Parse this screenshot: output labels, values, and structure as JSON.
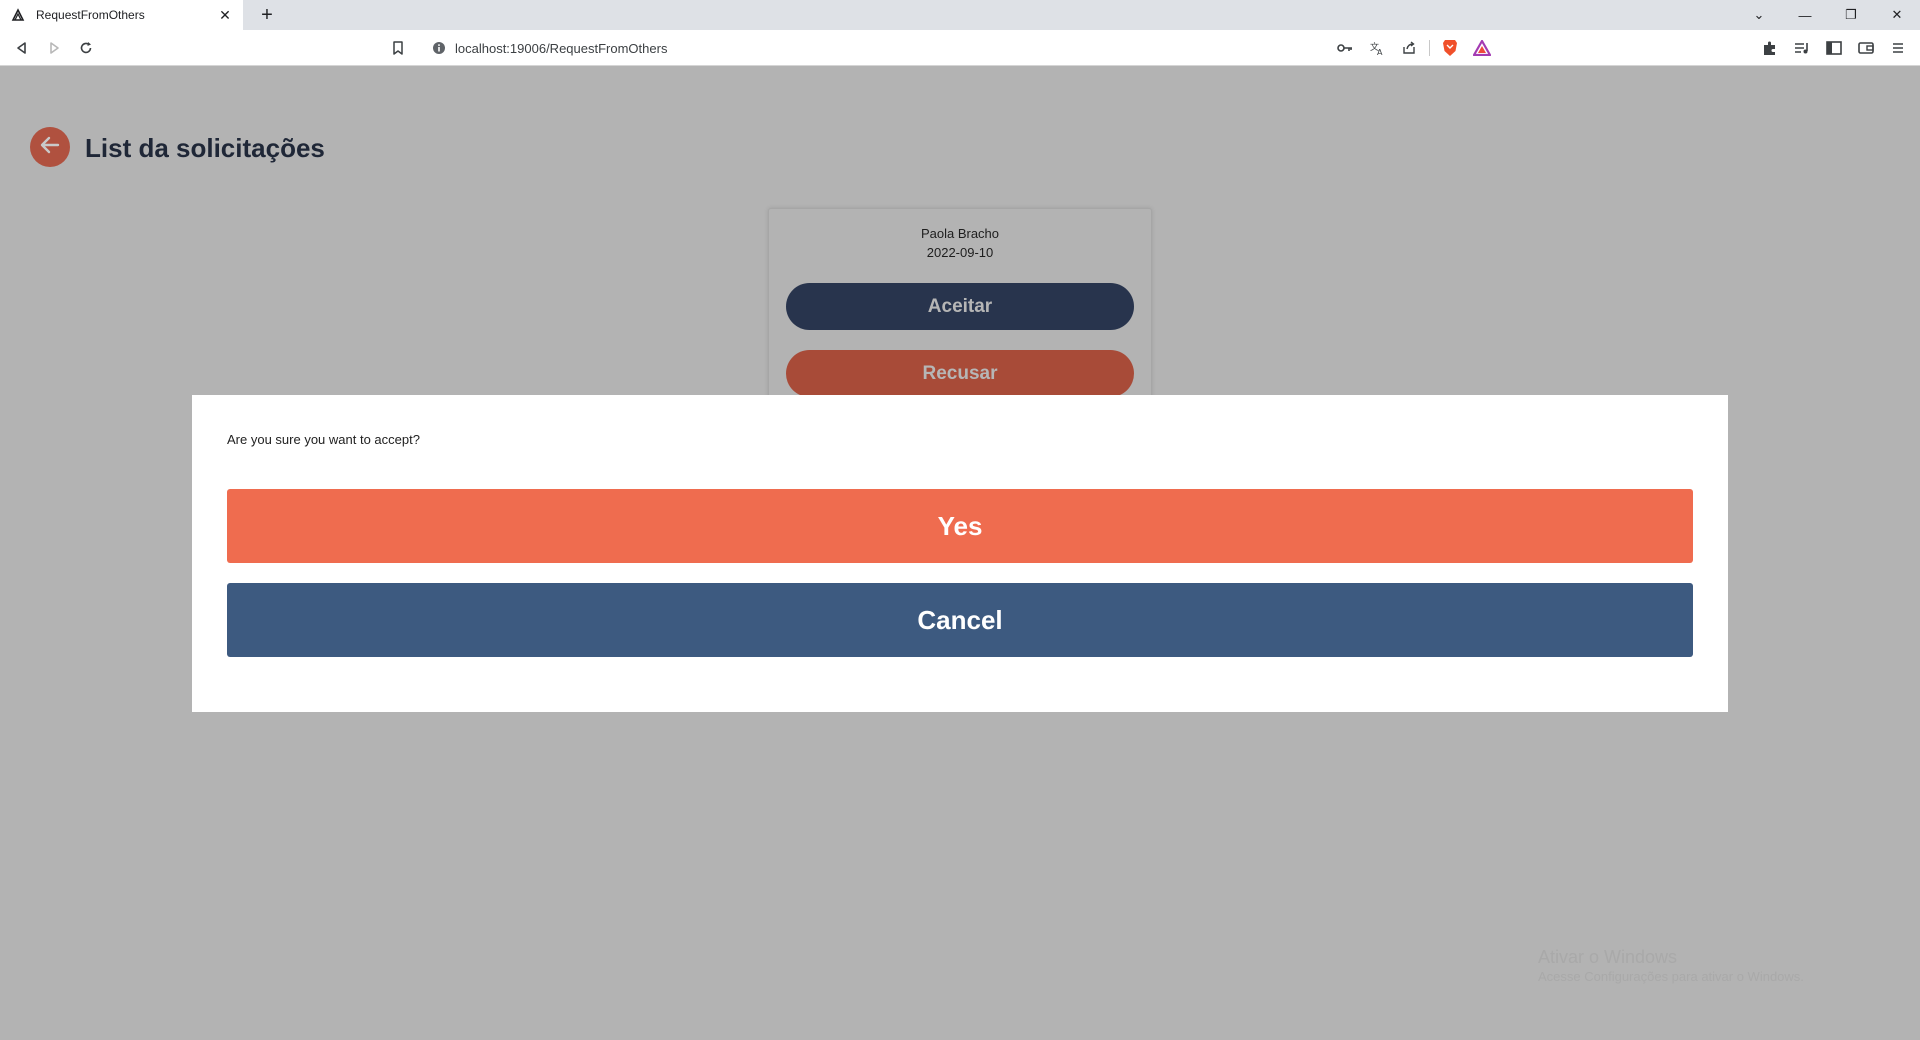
{
  "browser": {
    "tab_title": "RequestFromOthers",
    "tab_close": "✕",
    "new_tab": "+",
    "url": "localhost:19006/RequestFromOthers",
    "window_controls": {
      "dropdown": "⌄",
      "minimize": "—",
      "restore": "❐",
      "close": "✕"
    }
  },
  "page": {
    "title": "List da solicitações"
  },
  "request": {
    "name": "Paola Bracho",
    "date": "2022-09-10",
    "accept_label": "Aceitar",
    "refuse_label": "Recusar"
  },
  "dialog": {
    "message": "Are you sure you want to accept?",
    "yes_label": "Yes",
    "cancel_label": "Cancel"
  },
  "watermark": {
    "title": "Ativar o Windows",
    "subtitle": "Acesse Configurações para ativar o Windows."
  },
  "colors": {
    "back_button": "#b0513f",
    "accept_pill": "#28344d",
    "refuse_pill": "#a84b38",
    "yes_button": "#ef6c4f",
    "cancel_button": "#3d5a80",
    "backdrop": "#b3b3b3"
  }
}
